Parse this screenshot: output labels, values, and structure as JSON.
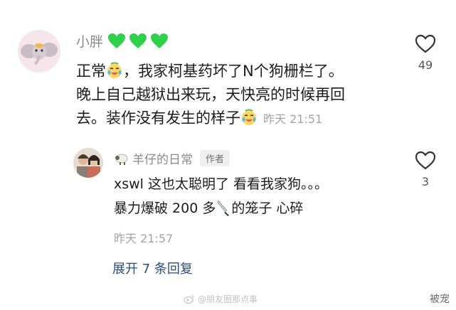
{
  "main_comment": {
    "username": "小胖",
    "line1_pre": "正常",
    "line1_post": "，我家柯基药坏了N个狗栅栏了。",
    "line2": "晚上自己越狱出来玩，天快亮的时候再回",
    "line3": "去。装作没有发生的样子",
    "timestamp": "昨天 21:51",
    "like_count": "49",
    "emoji_icon": "crying-laughing-emoji-icon"
  },
  "reply": {
    "username": "羊仔的日常",
    "author_tag": "作者",
    "line1": "xswl 这也太聪明了 看看我家狗。。。",
    "line2_pre": "暴力爆破 200 多",
    "line2_post": "的笼子 心碎",
    "timestamp": "昨天 21:57",
    "like_count": "3"
  },
  "expand": {
    "label": "展开 7 条回复"
  },
  "watermark": {
    "text": "@朋友圈那点事"
  },
  "corner_mark": {
    "text": "被宠"
  },
  "colors": {
    "green_heart": "#2fd14a",
    "link": "#2b4e7a",
    "meta": "#a3a3a3"
  }
}
